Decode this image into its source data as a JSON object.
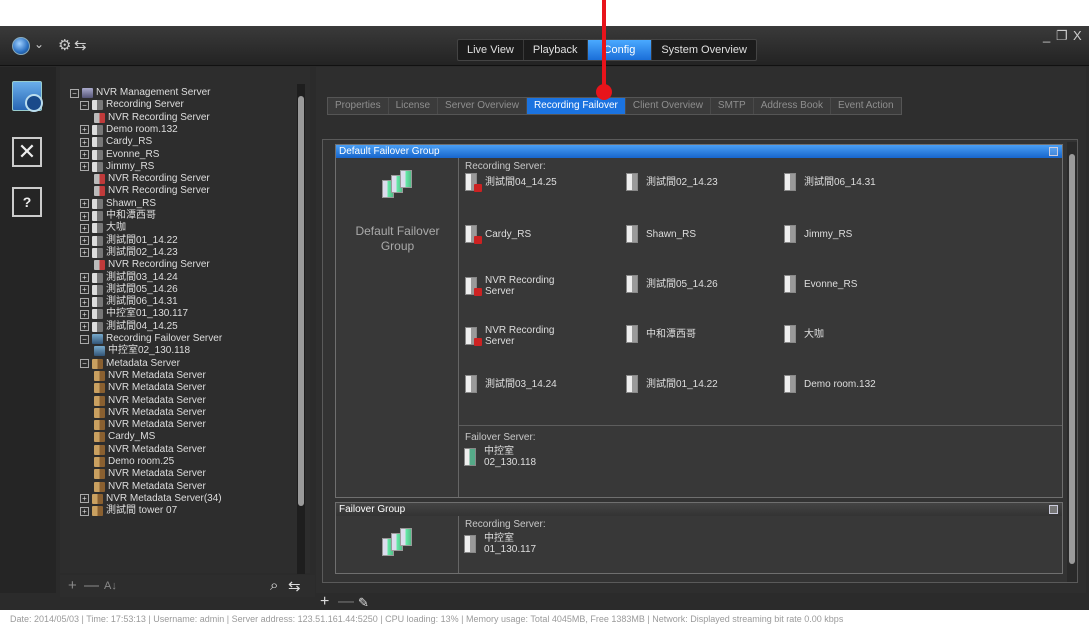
{
  "titlebar": {
    "tabs": [
      "Live View",
      "Playback",
      "Config",
      "System Overview"
    ],
    "active_tab": "Config",
    "logo_icon": "globe-icon",
    "minimize": "_",
    "restore": "❐",
    "close": "X"
  },
  "sub_tabs": [
    "Properties",
    "License",
    "Server Overview",
    "Recording Failover",
    "Client Overview",
    "SMTP",
    "Address Book",
    "Event Action"
  ],
  "tree": {
    "items": [
      {
        "label": "NVR Management Server",
        "icon": "mgmt"
      },
      {
        "label": "Recording Server",
        "icon": "srv"
      },
      {
        "label": "NVR Recording Server",
        "icon": "red"
      },
      {
        "label": "Demo room.132",
        "icon": "srv"
      },
      {
        "label": "Cardy_RS",
        "icon": "srv"
      },
      {
        "label": "Evonne_RS",
        "icon": "srv"
      },
      {
        "label": "Jimmy_RS",
        "icon": "srv"
      },
      {
        "label": "NVR Recording Server",
        "icon": "red"
      },
      {
        "label": "NVR Recording Server",
        "icon": "red"
      },
      {
        "label": "Shawn_RS",
        "icon": "srv"
      },
      {
        "label": "中和潭西哥",
        "icon": "srv"
      },
      {
        "label": "大咖",
        "icon": "srv"
      },
      {
        "label": "測試間01_14.22",
        "icon": "srv"
      },
      {
        "label": "測試間02_14.23",
        "icon": "srv"
      },
      {
        "label": "NVR Recording Server",
        "icon": "red"
      },
      {
        "label": "測試間03_14.24",
        "icon": "srv"
      },
      {
        "label": "測試間05_14.26",
        "icon": "srv"
      },
      {
        "label": "測試間06_14.31",
        "icon": "srv"
      },
      {
        "label": "中控室01_130.117",
        "icon": "srv"
      },
      {
        "label": "測試間04_14.25",
        "icon": "srv"
      },
      {
        "label": "Recording Failover Server",
        "icon": "blue"
      },
      {
        "label": "中控室02_130.118",
        "icon": "blue"
      },
      {
        "label": "Metadata Server",
        "icon": "meta"
      },
      {
        "label": "NVR Metadata Server",
        "icon": "meta"
      },
      {
        "label": "NVR Metadata Server",
        "icon": "meta"
      },
      {
        "label": "NVR Metadata Server",
        "icon": "meta"
      },
      {
        "label": "NVR Metadata Server",
        "icon": "meta"
      },
      {
        "label": "NVR Metadata Server",
        "icon": "meta"
      },
      {
        "label": "Cardy_MS",
        "icon": "meta"
      },
      {
        "label": "NVR Metadata Server",
        "icon": "meta"
      },
      {
        "label": "Demo room.25",
        "icon": "meta"
      },
      {
        "label": "NVR Metadata Server",
        "icon": "meta"
      },
      {
        "label": "NVR Metadata Server",
        "icon": "meta"
      },
      {
        "label": "NVR Metadata Server(34)",
        "icon": "meta"
      },
      {
        "label": "測試間 tower 07",
        "icon": "meta"
      }
    ]
  },
  "group1": {
    "header": "Default Failover Group",
    "name_line1": "Default Failover",
    "name_line2": "Group",
    "recording_label": "Recording Server:",
    "failover_label": "Failover Server:",
    "servers": [
      {
        "name": "測試間04_14.25",
        "status": "bad"
      },
      {
        "name": "測試間02_14.23",
        "status": "ok"
      },
      {
        "name": "測試間06_14.31",
        "status": "ok"
      },
      {
        "name": "Cardy_RS",
        "status": "bad"
      },
      {
        "name": "Shawn_RS",
        "status": "ok"
      },
      {
        "name": "Jimmy_RS",
        "status": "ok"
      },
      {
        "name": "NVR Recording\nServer",
        "status": "bad"
      },
      {
        "name": "測試間05_14.26",
        "status": "ok"
      },
      {
        "name": "Evonne_RS",
        "status": "ok"
      },
      {
        "name": "NVR Recording\nServer",
        "status": "bad"
      },
      {
        "name": "中和潭西哥",
        "status": "ok"
      },
      {
        "name": "大咖",
        "status": "ok"
      },
      {
        "name": "測試間03_14.24",
        "status": "ok"
      },
      {
        "name": "測試間01_14.22",
        "status": "ok"
      },
      {
        "name": "Demo room.132",
        "status": "ok"
      }
    ],
    "failover_server_line1": "中控室",
    "failover_server_line2": "02_130.118"
  },
  "group2": {
    "header": "Failover Group",
    "recording_label": "Recording Server:",
    "server_line1": "中控室",
    "server_line2": "01_130.117"
  },
  "statusbar": {
    "text": "Date: 2014/05/03  |  Time: 17:53:13  |  Username: admin  |  Server address: 123.51.161.44:5250  |  CPU loading: 13%  |  Memory usage: Total 4045MB, Free 1383MB  |  Network: Displayed streaming bit rate    0.00 kbps"
  }
}
